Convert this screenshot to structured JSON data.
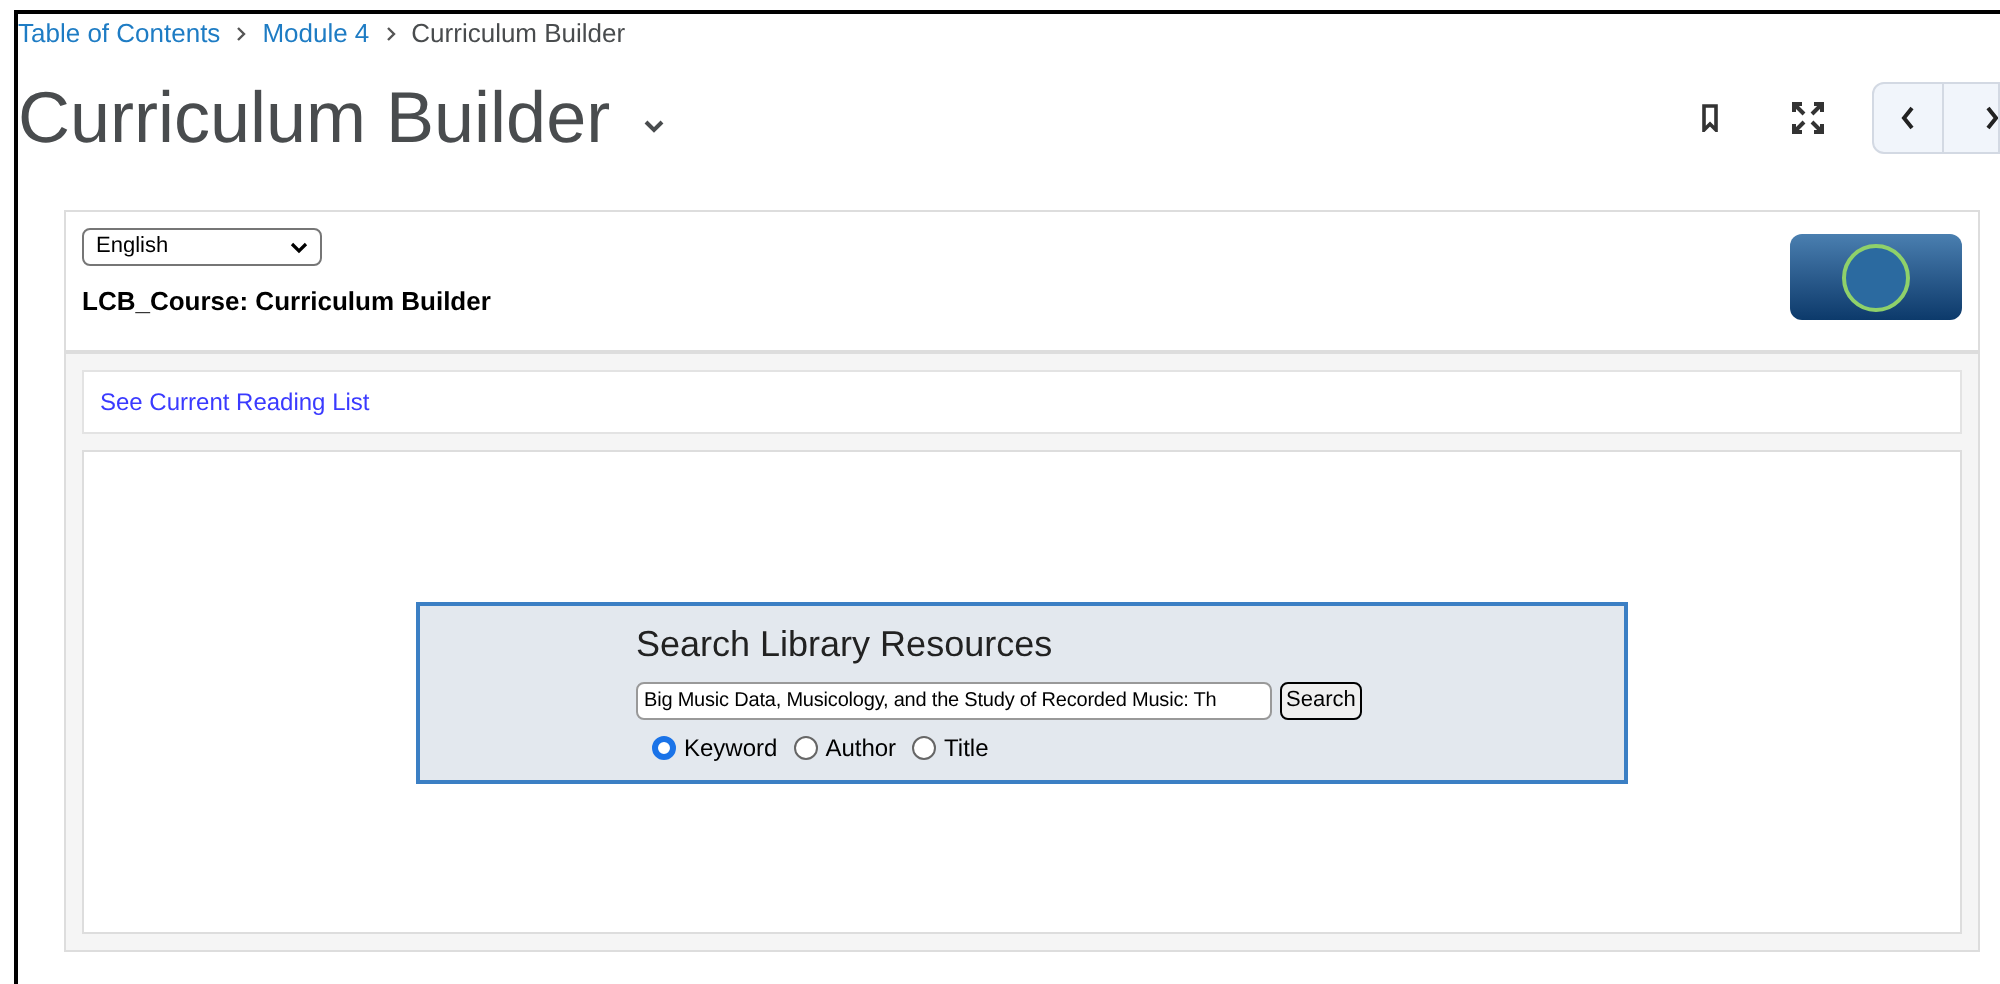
{
  "breadcrumbs": [
    {
      "label": "Table of Contents",
      "link": true
    },
    {
      "label": "Module 4",
      "link": true
    },
    {
      "label": "Curriculum Builder",
      "link": false
    }
  ],
  "page_title": "Curriculum Builder",
  "language_select": {
    "value": "English"
  },
  "course_title": "LCB_Course: Curriculum Builder",
  "reading_list_link": "See Current Reading List",
  "search": {
    "heading": "Search Library Resources",
    "value": "Big Music Data, Musicology, and the Study of Recorded Music: Th",
    "button": "Search",
    "options": [
      {
        "label": "Keyword",
        "selected": true
      },
      {
        "label": "Author",
        "selected": false
      },
      {
        "label": "Title",
        "selected": false
      }
    ]
  }
}
